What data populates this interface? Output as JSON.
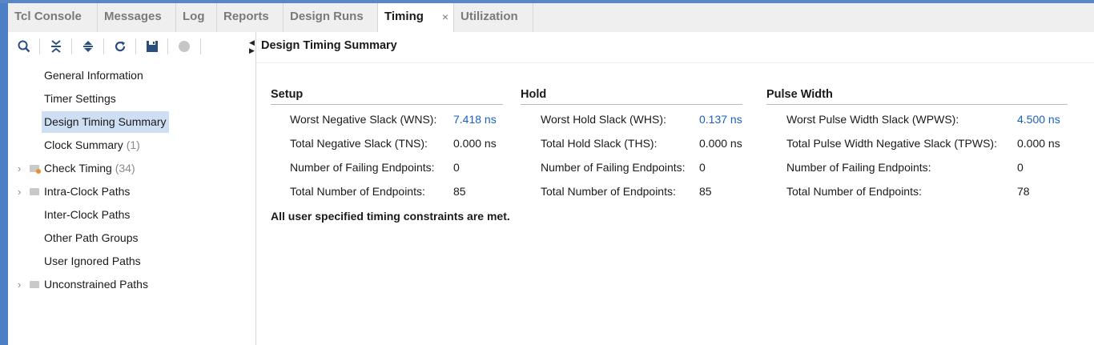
{
  "tabs": [
    {
      "label": "Tcl Console"
    },
    {
      "label": "Messages"
    },
    {
      "label": "Log"
    },
    {
      "label": "Reports"
    },
    {
      "label": "Design Runs"
    },
    {
      "label": "Timing",
      "close": "×"
    },
    {
      "label": "Utilization"
    }
  ],
  "toolbar": {
    "icons": [
      "search-icon",
      "collapse-all-icon",
      "expand-all-icon",
      "refresh-icon",
      "save-icon",
      "stop-icon"
    ]
  },
  "tree": {
    "items": [
      {
        "label": "General Information"
      },
      {
        "label": "Timer Settings"
      },
      {
        "label": "Design Timing Summary",
        "selected": true
      },
      {
        "label": "Clock Summary",
        "count": "(1)"
      },
      {
        "label": "Check Timing",
        "count": "(34)",
        "chev": "›"
      },
      {
        "label": "Intra-Clock Paths",
        "chev": "›"
      },
      {
        "label": "Inter-Clock Paths"
      },
      {
        "label": "Other Path Groups"
      },
      {
        "label": "User Ignored Paths"
      },
      {
        "label": "Unconstrained Paths",
        "chev": "›"
      }
    ]
  },
  "main": {
    "title": "Design Timing Summary",
    "setup": {
      "title": "Setup",
      "rows": [
        {
          "label": "Worst Negative Slack (WNS):",
          "value": "7.418 ns"
        },
        {
          "label": "Total Negative Slack (TNS):",
          "value": "0.000 ns"
        },
        {
          "label": "Number of Failing Endpoints:",
          "value": "0"
        },
        {
          "label": "Total Number of Endpoints:",
          "value": "85"
        }
      ]
    },
    "hold": {
      "title": "Hold",
      "rows": [
        {
          "label": "Worst Hold Slack (WHS):",
          "value": "0.137 ns"
        },
        {
          "label": "Total Hold Slack (THS):",
          "value": "0.000 ns"
        },
        {
          "label": "Number of Failing Endpoints:",
          "value": "0"
        },
        {
          "label": "Total Number of Endpoints:",
          "value": "85"
        }
      ]
    },
    "pulse": {
      "title": "Pulse Width",
      "rows": [
        {
          "label": "Worst Pulse Width Slack (WPWS):",
          "value": "4.500 ns"
        },
        {
          "label": "Total Pulse Width Negative Slack (TPWS):",
          "value": "0.000 ns"
        },
        {
          "label": "Number of Failing Endpoints:",
          "value": "0"
        },
        {
          "label": "Total Number of Endpoints:",
          "value": "78"
        }
      ]
    },
    "note": "All user specified timing constraints are met."
  },
  "colors": {
    "accent": "#4d7fc4",
    "link": "#1a5fc0",
    "selection": "#cfdff3"
  }
}
